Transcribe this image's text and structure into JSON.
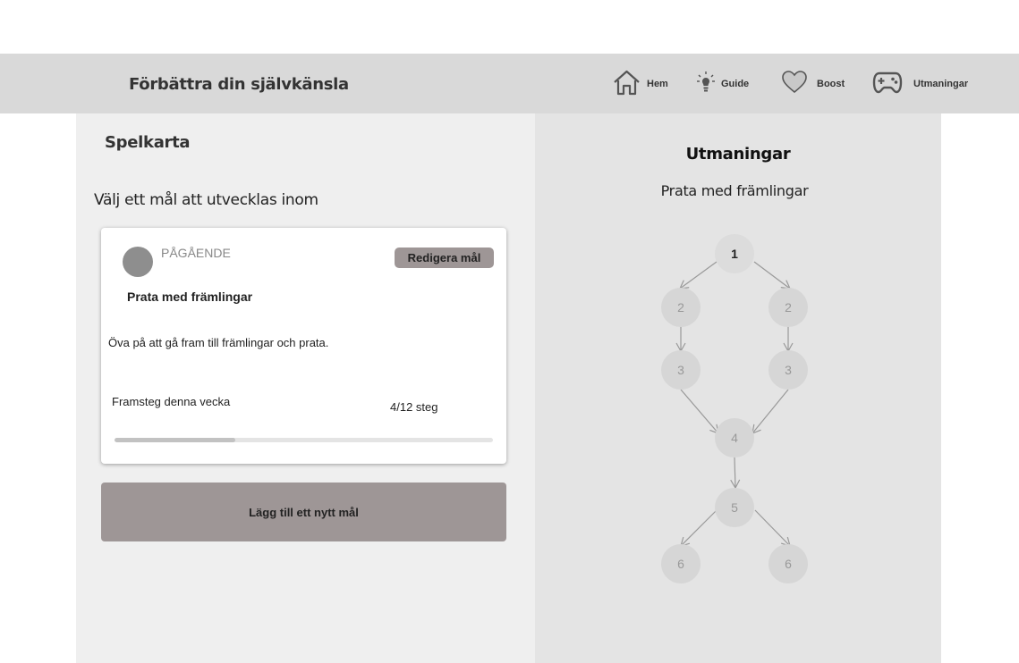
{
  "header": {
    "title": "Förbättra din självkänsla",
    "nav": [
      {
        "label": "Hem",
        "icon": "home-icon"
      },
      {
        "label": "Guide",
        "icon": "lightbulb-icon"
      },
      {
        "label": "Boost",
        "icon": "heart-icon"
      },
      {
        "label": "Utmaningar",
        "icon": "gamepad-icon"
      }
    ]
  },
  "left": {
    "title": "Spelkarta",
    "subtitle": "Välj ett mål att utvecklas inom",
    "goal_card": {
      "status": "PÅGÅENDE",
      "edit_label": "Redigera mål",
      "name": "Prata med främlingar",
      "description": "Öva på att gå fram till främlingar och prata.",
      "progress_label": "Framsteg denna vecka",
      "progress_count": "4/12 steg",
      "progress_fraction": 0.32
    },
    "add_goal_label": "Lägg till ett nytt mål"
  },
  "right": {
    "title": "Utmaningar",
    "subtitle": "Prata med främlingar",
    "map_nodes": [
      "1",
      "2",
      "2",
      "3",
      "3",
      "4",
      "5",
      "6",
      "6"
    ]
  },
  "colors": {
    "header_bg": "#d9d9d9",
    "left_bg": "#efefef",
    "right_bg": "#e4e4e4",
    "button_bg": "#9e9696",
    "node_bg": "#d6d6d6"
  }
}
